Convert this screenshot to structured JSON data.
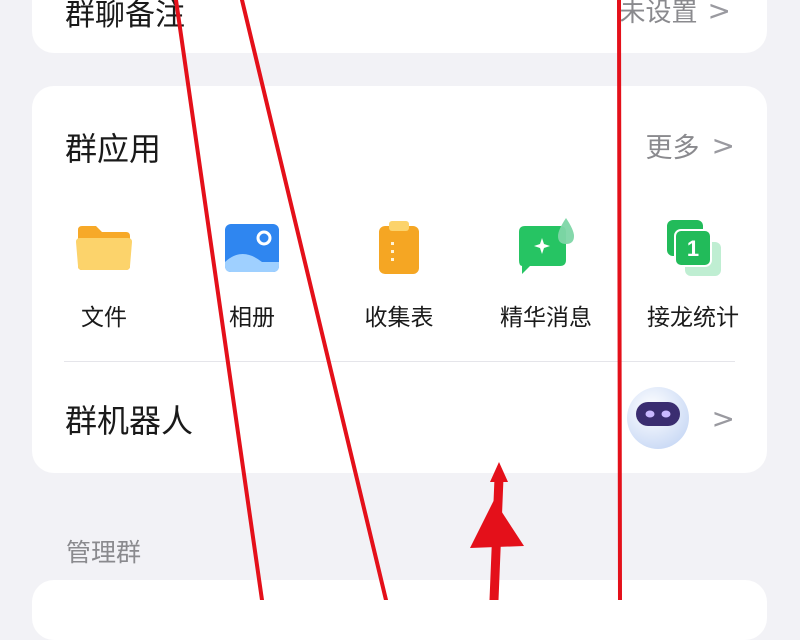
{
  "top_row": {
    "title": "群聊备注",
    "value": "未设置"
  },
  "group_apps": {
    "title": "群应用",
    "more_label": "更多",
    "items": [
      {
        "label": "文件",
        "icon": "folder-icon",
        "color": "#f9b233"
      },
      {
        "label": "相册",
        "icon": "photo-album-icon",
        "color": "#2f86f0"
      },
      {
        "label": "收集表",
        "icon": "clipboard-icon",
        "color": "#f5a623"
      },
      {
        "label": "精华消息",
        "icon": "highlight-message-icon",
        "color": "#26c463"
      },
      {
        "label": "接龙统计",
        "icon": "relay-stats-icon",
        "color": "#22bb5a"
      }
    ]
  },
  "group_bot": {
    "label": "群机器人"
  },
  "manage_section": {
    "label": "管理群"
  },
  "colors": {
    "background": "#f2f2f6",
    "card": "#ffffff",
    "annotation": "#e4101a",
    "secondary_text": "#8a8a8e"
  }
}
